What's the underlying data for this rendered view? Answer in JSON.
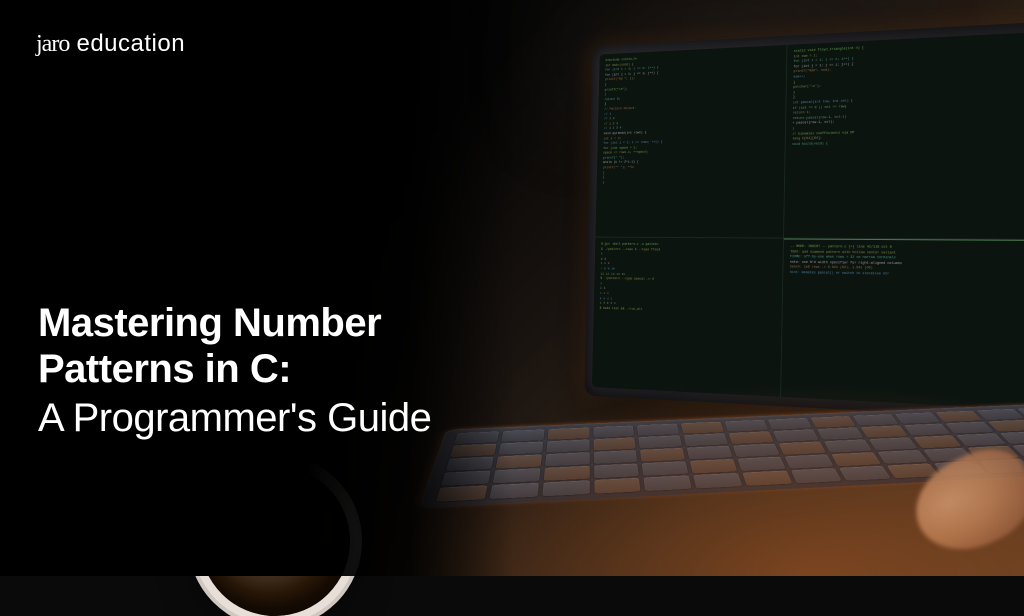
{
  "logo": {
    "brand": "jaro",
    "suffix": "education"
  },
  "heading": {
    "title_line1": "Mastering Number",
    "title_line2": "Patterns in C:",
    "subtitle": "A Programmer's Guide"
  },
  "code_content": {
    "pane_tl": [
      "#include <stdio.h>",
      "int main(void) {",
      "  for (int i = 1; i <= n; i++) {",
      "    for (int j = 1; j <= i; j++) {",
      "      printf(\"%d \", j);",
      "    }",
      "    printf(\"\\n\");",
      "  }",
      "  return 0;",
      "}",
      "// Pattern Output:",
      "// 1",
      "// 1 2",
      "// 1 2 3",
      "// 1 2 3 4",
      "void pyramid(int rows) {",
      "  int k = 0;",
      "  for (int i = 1; i <= rows; ++i) {",
      "    for (int space = 1;",
      "         space <= rows-i; ++space)",
      "      printf(\"  \");",
      "    while (k != 2*i-1) {",
      "      printf(\"* \"); ++k;",
      "    }",
      "  }",
      "}"
    ],
    "pane_tr": [
      "static void floyd_triangle(int n) {",
      "  int num = 1;",
      "  for (int i = 1; i <= n; i++) {",
      "    for (int j = 1; j <= i; j++) {",
      "      printf(\"%3d\", num);",
      "      num++;",
      "    }",
      "    putchar('\\n');",
      "  }",
      "}",
      "",
      "int pascal(int row, int col) {",
      "  if (col == 0 || col == row)",
      "    return 1;",
      "  return pascal(row-1, col-1)",
      "       + pascal(row-1, col);",
      "}",
      "",
      "// binomial coefficients via DP",
      "long C[64][64];",
      "void build(void) {"
    ],
    "pane_bl": [
      "$ gcc -Wall pattern.c -o pattern",
      "$ ./pattern --rows 5 --type floyd",
      "  1",
      "  2  3",
      "  4  5  6",
      "  7  8  9 10",
      " 11 12 13 14 15",
      "$ ./pattern --type pascal -n 6",
      "      1",
      "     1 1",
      "    1 2 1",
      "   1 3 3 1",
      "  1 4 6 4 1",
      "$ make test && ./run_all"
    ],
    "pane_br": [
      "-- MODE: INSERT -- pattern.c [+] line 42/118 col 8",
      "TODO: add diamond pattern with hollow center variant",
      "FIXME: off-by-one when rows > 32 on narrow terminals",
      "note: use %*d width specifier for right-aligned columns",
      "bench: 1e6 rows -> 0.82s (O2), 1.94s (O0)",
      "hint: memoize pascal() or switch to iterative nCr"
    ]
  },
  "colors": {
    "background": "#000000",
    "text": "#ffffff",
    "terminal_bg": "#0c1410",
    "code_green": "#7aba5a",
    "code_olive": "#9a9a4a",
    "warm_glow": "#c86428"
  }
}
